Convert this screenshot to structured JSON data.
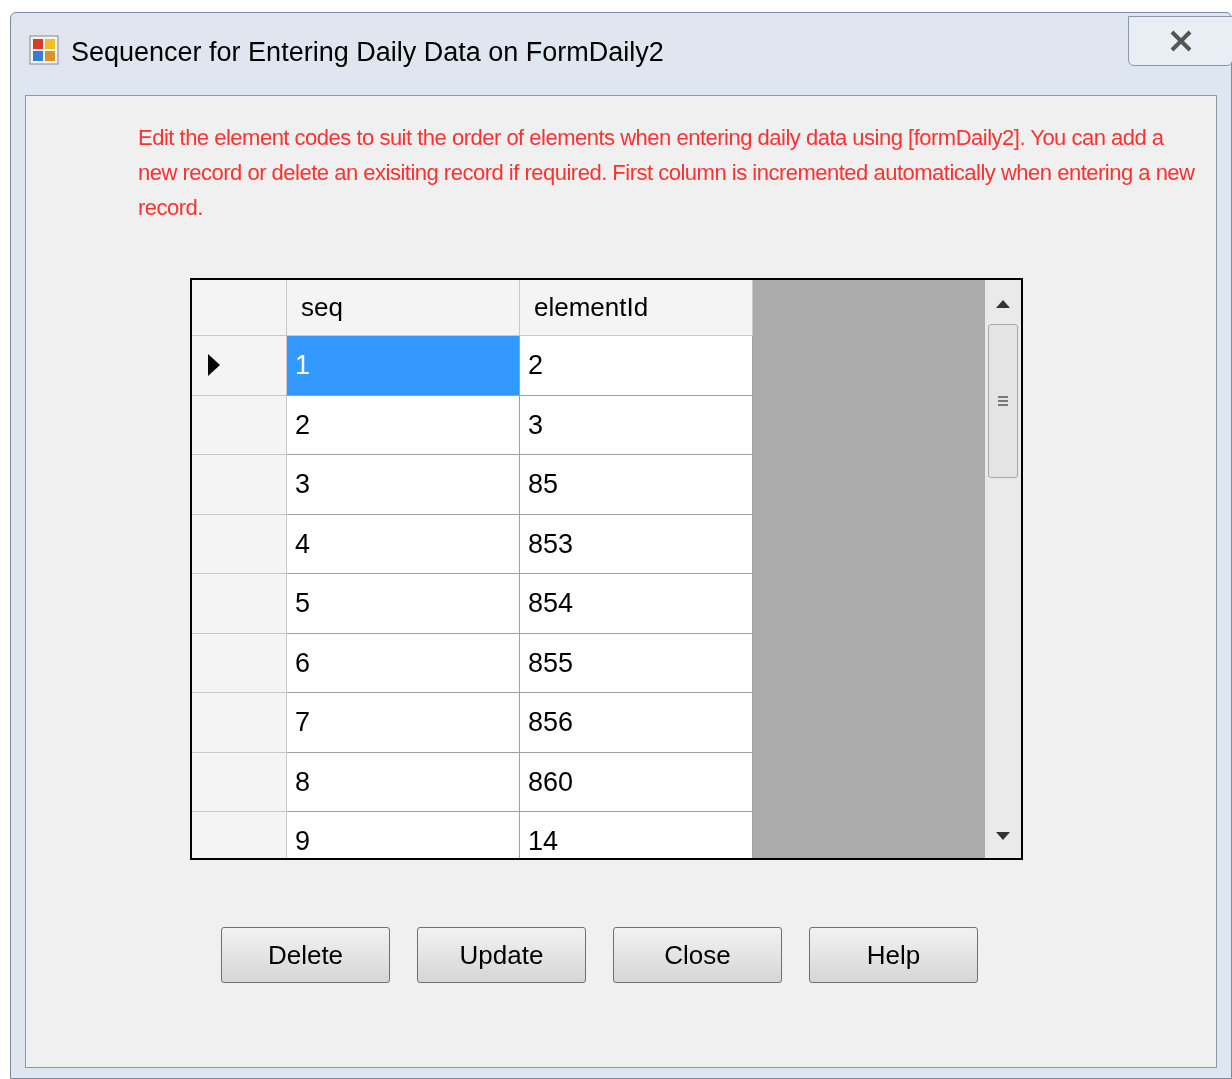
{
  "window": {
    "title": "Sequencer for Entering Daily Data on FormDaily2"
  },
  "instructions": "Edit the element codes  to suit the order of elements when entering daily data using [formDaily2]. You can add a new record or delete an exisiting record if required. First column is incremented automatically when entering a new record.",
  "table": {
    "columns": [
      "seq",
      "elementId"
    ],
    "rows": [
      {
        "seq": "1",
        "elementId": "2",
        "selected": true
      },
      {
        "seq": "2",
        "elementId": "3",
        "selected": false
      },
      {
        "seq": "3",
        "elementId": "85",
        "selected": false
      },
      {
        "seq": "4",
        "elementId": "853",
        "selected": false
      },
      {
        "seq": "5",
        "elementId": "854",
        "selected": false
      },
      {
        "seq": "6",
        "elementId": "855",
        "selected": false
      },
      {
        "seq": "7",
        "elementId": "856",
        "selected": false
      },
      {
        "seq": "8",
        "elementId": "860",
        "selected": false
      },
      {
        "seq": "9",
        "elementId": "14",
        "selected": false
      }
    ]
  },
  "buttons": [
    "Delete",
    "Update",
    "Close",
    "Help"
  ]
}
